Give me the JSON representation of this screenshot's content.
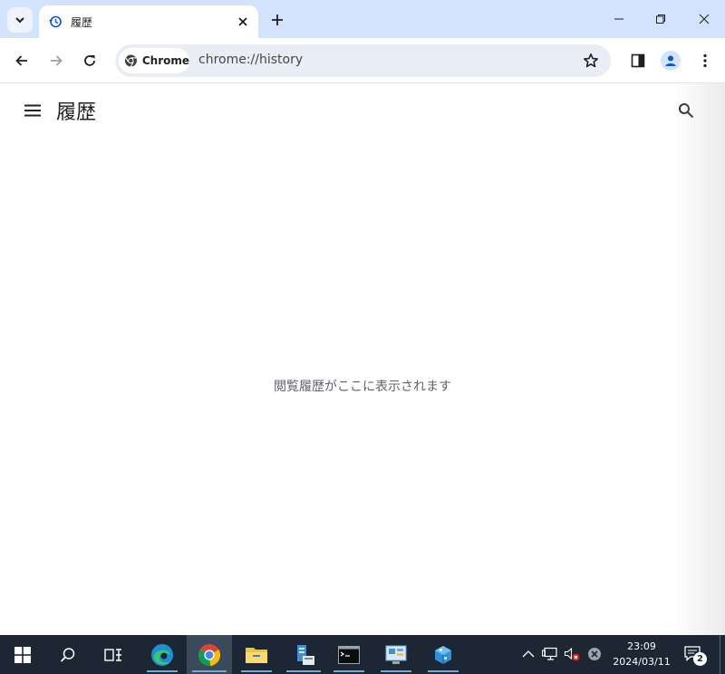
{
  "browser": {
    "tab": {
      "title": "履歴"
    },
    "omnibox": {
      "chip_label": "Chrome",
      "url": "chrome://history"
    }
  },
  "page": {
    "title": "履歴",
    "empty_message": "閲覧履歴がここに表示されます"
  },
  "taskbar": {
    "apps": [
      "start-icon",
      "search-icon",
      "task-view-icon",
      "edge-icon",
      "chrome-icon",
      "file-explorer-icon",
      "server-manager-icon",
      "cmd-icon",
      "control-panel-icon",
      "package-icon"
    ],
    "clock": {
      "time": "23:09",
      "date": "2024/03/11"
    },
    "notification_count": "2"
  },
  "colors": {
    "tabstrip_bg": "#d3e3fd",
    "omnibox_bg": "#e9eef6",
    "taskbar_bg": "#1c2733",
    "accent": "#0b57d0"
  }
}
